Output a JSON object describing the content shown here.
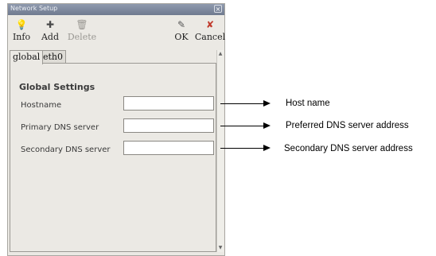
{
  "window": {
    "title": "Network Setup",
    "close_glyph": "×"
  },
  "toolbar": {
    "info": {
      "label": "Info",
      "icon": "info-bulb-icon",
      "glyph": "💡"
    },
    "add": {
      "label": "Add",
      "icon": "add-icon",
      "glyph": "✚"
    },
    "delete": {
      "label": "Delete",
      "icon": "trash-icon",
      "glyph": "🗑"
    },
    "ok": {
      "label": "OK",
      "icon": "ok-icon",
      "glyph": "✎"
    },
    "cancel": {
      "label": "Cancel",
      "icon": "cancel-icon",
      "glyph": "✘"
    }
  },
  "tabs": [
    "global",
    "eth0"
  ],
  "settings": {
    "title": "Global Settings",
    "fields": [
      {
        "label": "Hostname",
        "value": ""
      },
      {
        "label": "Primary DNS server",
        "value": ""
      },
      {
        "label": "Secondary DNS server",
        "value": ""
      }
    ]
  },
  "annotations": [
    "Host name",
    "Preferred DNS server address",
    "Secondary DNS server address"
  ],
  "colors": {
    "titlebar": "#7d879b",
    "window_bg": "#ebe9e4",
    "cancel_icon": "#c0392b"
  }
}
